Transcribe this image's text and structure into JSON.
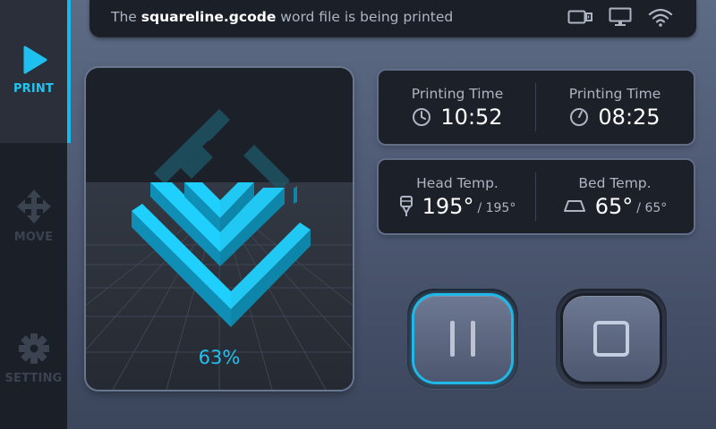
{
  "sidebar": {
    "items": [
      {
        "label": "PRINT",
        "icon": "play-icon",
        "active": true
      },
      {
        "label": "MOVE",
        "icon": "move-arrows-icon",
        "active": false
      },
      {
        "label": "SETTING",
        "icon": "gear-icon",
        "active": false
      }
    ]
  },
  "status": {
    "prefix": "The",
    "filename": "squareline.gcode",
    "suffix": "word file is being printed",
    "icons": [
      "sd-card-icon",
      "monitor-icon",
      "wifi-icon"
    ]
  },
  "preview": {
    "percent": "63%",
    "progress": 0.63
  },
  "time_card": {
    "left": {
      "title": "Printing Time",
      "value": "10:52",
      "icon": "clock-icon"
    },
    "right": {
      "title": "Printing Time",
      "value": "08:25",
      "icon": "clock-remaining-icon"
    }
  },
  "temp_card": {
    "left": {
      "title": "Head Temp.",
      "value": "195°",
      "target": "/ 195°",
      "icon": "nozzle-icon"
    },
    "right": {
      "title": "Bed Temp.",
      "value": "65°",
      "target": "/ 65°",
      "icon": "bed-icon"
    }
  },
  "buttons": {
    "pause": {
      "icon": "pause-icon"
    },
    "stop": {
      "icon": "stop-icon"
    }
  },
  "colors": {
    "accent": "#18b9ea",
    "panel": "#1c2029",
    "sidebar": "#1b1f28",
    "background": "#4b5670"
  }
}
